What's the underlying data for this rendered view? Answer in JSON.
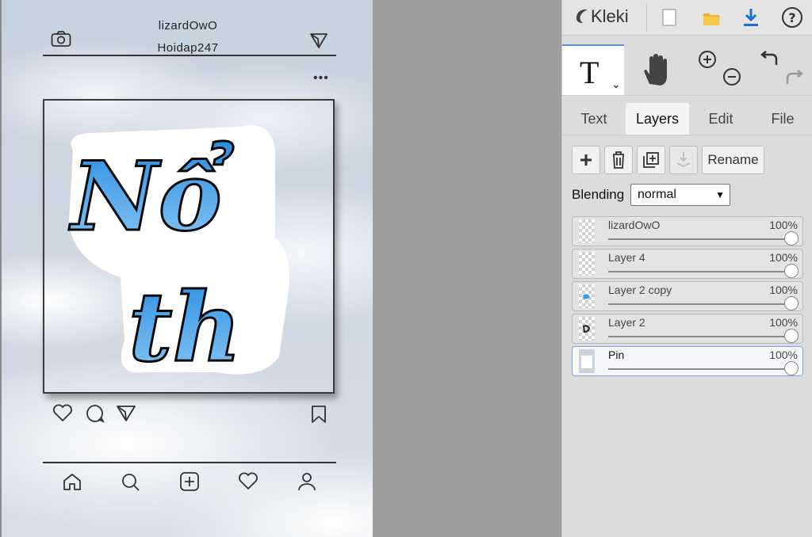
{
  "canvas": {
    "post": {
      "username": "lizardOwO",
      "subtitle": "Hoidap247",
      "sticker_line1": "Nổ",
      "sticker_line2": "th"
    }
  },
  "panel": {
    "app_name": "Kleki",
    "tabs": [
      "Text",
      "Layers",
      "Edit",
      "File"
    ],
    "active_tab": "Layers",
    "rename_label": "Rename",
    "blending_label": "Blending",
    "blending_value": "normal",
    "layers": [
      {
        "name": "lizardOwO",
        "opacity": "100%",
        "opacity_value": 1.0
      },
      {
        "name": "Layer 4",
        "opacity": "100%",
        "opacity_value": 1.0
      },
      {
        "name": "Layer 2 copy",
        "opacity": "100%",
        "opacity_value": 1.0
      },
      {
        "name": "Layer 2",
        "opacity": "100%",
        "opacity_value": 1.0
      },
      {
        "name": "Pin",
        "opacity": "100%",
        "opacity_value": 1.0,
        "selected": true
      }
    ]
  },
  "colors": {
    "accent": "#5a8fd8",
    "download": "#1a6fd6",
    "folder": "#f2b52a",
    "sticker_blue": "#3d9be4"
  }
}
